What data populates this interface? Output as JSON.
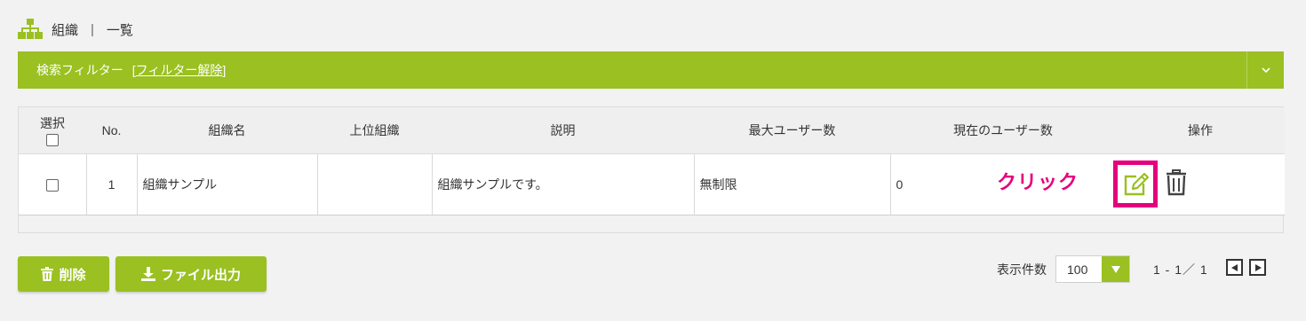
{
  "breadcrumb": {
    "icon": "org-tree-icon",
    "section": "組織",
    "separator": "|",
    "page": "一覧"
  },
  "filter": {
    "title": "検索フィルター",
    "open_bracket": "[",
    "clear_link": "フィルター解除",
    "close_bracket": "]"
  },
  "table": {
    "headers": {
      "select": "選択",
      "no": "No.",
      "name": "組織名",
      "parent": "上位組織",
      "description": "説明",
      "max_users": "最大ユーザー数",
      "current_users": "現在のユーザー数",
      "actions": "操作"
    },
    "rows": [
      {
        "no": "1",
        "name": "組織サンプル",
        "parent": "",
        "description": "組織サンプルです。",
        "max_users": "無制限",
        "current_users": "0"
      }
    ]
  },
  "annotation": {
    "click_label": "クリック"
  },
  "buttons": {
    "delete": "削除",
    "export": "ファイル出力"
  },
  "pagination": {
    "per_page_label": "表示件数",
    "per_page_value": "100",
    "range": "1 - 1／ 1"
  },
  "colors": {
    "accent": "#9ac021",
    "highlight": "#e6007e"
  }
}
